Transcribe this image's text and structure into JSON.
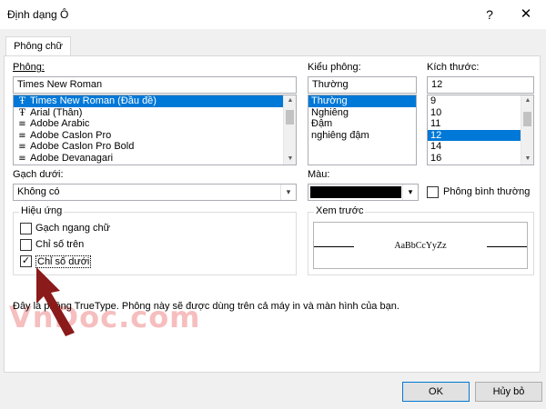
{
  "window": {
    "title": "Định dạng Ô",
    "help_glyph": "?",
    "close_glyph": "✕"
  },
  "tabs": [
    {
      "label": "Phông chữ",
      "active": true
    }
  ],
  "font": {
    "label": "Phông:",
    "value": "Times New Roman",
    "items": [
      {
        "label": "Times New Roman (Đầu đề)",
        "icon": "truetype-font-icon",
        "selected": true
      },
      {
        "label": "Arial (Thân)",
        "icon": "truetype-font-icon",
        "selected": false
      },
      {
        "label": "Adobe Arabic",
        "icon": "opentype-font-icon",
        "selected": false
      },
      {
        "label": "Adobe Caslon Pro",
        "icon": "opentype-font-icon",
        "selected": false
      },
      {
        "label": "Adobe Caslon Pro Bold",
        "icon": "opentype-font-icon",
        "selected": false
      },
      {
        "label": "Adobe Devanagari",
        "icon": "opentype-font-icon",
        "selected": false
      }
    ]
  },
  "style": {
    "label": "Kiểu phông:",
    "value": "Thường",
    "items": [
      {
        "label": "Thường",
        "selected": true
      },
      {
        "label": "Nghiêng",
        "selected": false
      },
      {
        "label": "Đậm",
        "selected": false
      },
      {
        "label": "nghiêng đậm",
        "selected": false
      }
    ]
  },
  "size": {
    "label": "Kích thước:",
    "value": "12",
    "items": [
      {
        "label": "9",
        "selected": false
      },
      {
        "label": "10",
        "selected": false
      },
      {
        "label": "11",
        "selected": false
      },
      {
        "label": "12",
        "selected": true
      },
      {
        "label": "14",
        "selected": false
      },
      {
        "label": "16",
        "selected": false
      }
    ]
  },
  "underline": {
    "label": "Gạch dưới:",
    "value": "Không có"
  },
  "color": {
    "label": "Màu:",
    "value_hex": "#000000",
    "normal_font_label": "Phông bình thường",
    "normal_font_checked": false
  },
  "effects": {
    "title": "Hiệu ứng",
    "items": [
      {
        "label": "Gạch ngang chữ",
        "checked": false
      },
      {
        "label": "Chỉ số trên",
        "checked": false
      },
      {
        "label": "Chỉ số dưới",
        "checked": true
      }
    ]
  },
  "preview": {
    "title": "Xem trước",
    "sample": "AaBbCcYyZz"
  },
  "note": "Đây là phông TrueType. Phông này sẽ được dùng trên cả máy in và màn hình của bạn.",
  "watermark": "VnDoc.com",
  "buttons": {
    "ok": "OK",
    "cancel": "Hủy bỏ"
  },
  "colors": {
    "selection": "#0078d7",
    "panel_bg": "#f0f0f0",
    "arrow": "#8b1a1a",
    "watermark": "#eb6e6e"
  }
}
